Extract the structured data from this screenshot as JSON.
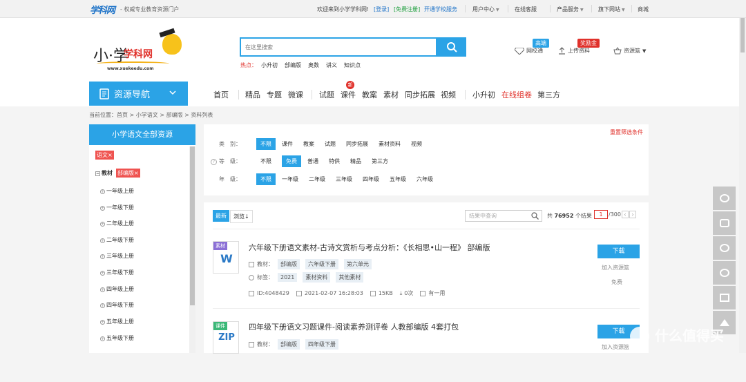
{
  "topbar": {
    "brand": "学科网",
    "slogan": "- 权威专业教育资源门户",
    "welcome": "欢迎来到小学学科网!",
    "login": "[登录]",
    "register": "[免费注册]",
    "open_school": "开通学校服务",
    "nav": [
      "用户中心",
      "在线客服",
      "产品服务",
      "旗下网站",
      "商城"
    ]
  },
  "logo": {
    "xiao": "小·学",
    "xue": "学科网",
    "url": "www.xuekeedu.com"
  },
  "search": {
    "placeholder": "在这里搜索",
    "hot_label": "热点：",
    "hot": [
      "小升初",
      "部编版",
      "奥数",
      "讲义",
      "知识点"
    ]
  },
  "header_tools": [
    {
      "label": "网校通",
      "badge": "高端"
    },
    {
      "label": "上传资料",
      "badge": "奖励金"
    },
    {
      "label": "资源篮",
      "badge": ""
    }
  ],
  "guide": {
    "label": "资源导航"
  },
  "mainnav": [
    "首页",
    "精品",
    "专题",
    "微课",
    "试题",
    "课件",
    "教案",
    "素材",
    "同步拓展",
    "视频",
    "小升初",
    "在线组卷",
    "第三方"
  ],
  "new_badge": "新",
  "breadcrumb": "当前位置：首页 > 小学语文 > 部编版 > 资料列表",
  "sidebar": {
    "title": "小学语文全部资源",
    "subject_tag": "语文×",
    "material_label": "教材",
    "edition_tag": "部编版×",
    "items": [
      "一年级上册",
      "一年级下册",
      "二年级上册",
      "二年级下册",
      "三年级上册",
      "三年级下册",
      "四年级上册",
      "四年级下册",
      "五年级上册",
      "五年级下册"
    ]
  },
  "filter": {
    "reset": "重置筛选条件",
    "rows": [
      {
        "key": "类　别：",
        "options": [
          "不限",
          "课件",
          "教案",
          "试题",
          "同步拓展",
          "素材资料",
          "视频"
        ],
        "selected": 0
      },
      {
        "key": "等　级：",
        "options": [
          "不限",
          "免费",
          "普通",
          "特供",
          "精品",
          "第三方"
        ],
        "selected": 1
      },
      {
        "key": "年　级：",
        "options": [
          "不限",
          "一年级",
          "二年级",
          "三年级",
          "四年级",
          "五年级",
          "六年级"
        ],
        "selected": 0
      }
    ]
  },
  "list": {
    "sort_latest": "最新",
    "sort_views": "浏览↓",
    "search_placeholder": "结果中查询",
    "total_prefix": "共",
    "total": "76952",
    "total_suffix": "个结果",
    "page": "1",
    "page_total": "/300",
    "items": [
      {
        "ext": "素材",
        "ext_color": "#8b6fd6",
        "letter": "W",
        "title": "六年级下册语文素材-古诗文赏析与考点分析：《长相思•山一程》 部编版",
        "material_label": "教材：",
        "material": [
          "部编版",
          "六年级下册",
          "第六单元"
        ],
        "tag_label": "标签：",
        "tags": [
          "2021",
          "素材资料",
          "其他素材"
        ],
        "id": "ID:4048429",
        "date": "2021-02-07 16:28:03",
        "size": "15KB",
        "downloads": "0次",
        "shares": "有一用",
        "download": "下载",
        "add": "加入资源篮",
        "price": "免费"
      },
      {
        "ext": "课件",
        "ext_color": "#3cb878",
        "letter": "ZIP",
        "title": "四年级下册语文习题课件-阅读素养测评卷 人教部编版 4套打包",
        "material_label": "教材：",
        "material": [
          "部编版",
          "四年级下册"
        ],
        "download": "下载",
        "add": "加入资源篮"
      }
    ]
  },
  "watermark": "什么值得买"
}
